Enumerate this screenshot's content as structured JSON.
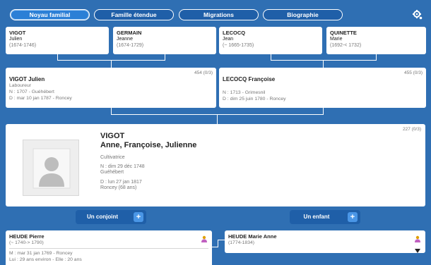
{
  "tabs": [
    {
      "label": "Noyau familial"
    },
    {
      "label": "Famille étendue"
    },
    {
      "label": "Migrations"
    },
    {
      "label": "Biographie"
    }
  ],
  "grandparents": [
    {
      "surname": "VIGOT",
      "given": "Julien",
      "dates": "(1674-1746)"
    },
    {
      "surname": "GERMAIN",
      "given": "Jeanne",
      "dates": "(1674-1729)"
    },
    {
      "surname": "LECOCQ",
      "given": "Jean",
      "dates": "(~ 1665-1735)"
    },
    {
      "surname": "QUINETTE",
      "given": "Marie",
      "dates": "(1692-< 1732)"
    }
  ],
  "parents": [
    {
      "name": "VIGOT Julien",
      "occupation": "Laboureur",
      "birth": "N : 1707 - Guéhébert",
      "death": "D : mar 10 jan 1787 - Roncey",
      "count": "454 (0/3)"
    },
    {
      "name": "LECOCQ Françoise",
      "occupation": "",
      "birth": "N : 1713 - Grimesnil",
      "death": "D : dim 25 juin 1780 - Roncey",
      "count": "455 (0/3)"
    }
  ],
  "subject": {
    "surname": "VIGOT",
    "given": "Anne, Françoise, Julienne",
    "occupation": "Cultivatrice",
    "birth_line1": "N : dim 29 déc 1748",
    "birth_line2": "Guéhébert",
    "death_line1": "D : lun 27 jan 1817",
    "death_line2": "Roncey (68 ans)",
    "count": "227 (0/3)"
  },
  "buttons": {
    "spouse": "Un conjoint",
    "child": "Un enfant",
    "plus": "+"
  },
  "spouse": {
    "name": "HEUDE Pierre",
    "dates": "(~ 1740-> 1790)",
    "marriage_line1": "M : mar 31 jan 1769 - Roncey",
    "marriage_line2": "Lui : 29 ans environ - Elle : 20 ans"
  },
  "child": {
    "name": "HEUDE Marie Anne",
    "dates": "(1774-1834)"
  },
  "icons": {
    "gear": "gear-icon",
    "person_placeholder": "person-silhouette-icon",
    "person_small": "person-icon",
    "chevron": "chevron-down-icon"
  }
}
